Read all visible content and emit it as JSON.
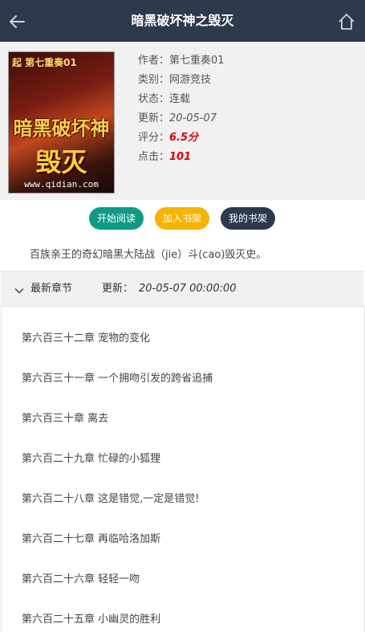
{
  "header": {
    "title": "暗黑破坏神之毁灭",
    "back_icon": "back-arrow-icon",
    "home_icon": "home-icon"
  },
  "book": {
    "cover": {
      "top_text": "起 第七重奏01",
      "title_line": "暗黑破坏神",
      "sub_line": "毁灭",
      "url": "www.qidian.com"
    },
    "meta": [
      {
        "label": "作者：",
        "value": "第七重奏01"
      },
      {
        "label": "类别：",
        "value": "网游竞技"
      },
      {
        "label": "状态：",
        "value": "连载"
      },
      {
        "label": "更新：",
        "value": "20-05-07"
      },
      {
        "label": "评分：",
        "value": "6.5分"
      },
      {
        "label": "点击：",
        "value": "101"
      }
    ],
    "description": "百族亲王的奇幻暗黑大陆战（jie）斗(cao)毁灭史。"
  },
  "actions": {
    "start_reading": "开始阅读",
    "add_shelf": "加入书架",
    "my_shelf": "我的书架"
  },
  "latest": {
    "label": "最新章节",
    "update_label": "更新：",
    "update_time": "20-05-07 00:00:00"
  },
  "chapters": [
    "第六百三十二章 宠物的变化",
    "第六百三十一章 一个拥吻引发的跨省追捕",
    "第六百三十章 离去",
    "第六百二十九章 忙碌的小狐狸",
    "第六百二十八章 这是错觉,一定是错觉!",
    "第六百二十七章 再临哈洛加斯",
    "第六百二十六章 轻轻一吻",
    "第六百二十五章 小幽灵的胜利"
  ],
  "colors": {
    "header_bg": "#2d3a4c",
    "read_btn": "#0d9b86",
    "add_btn": "#f5b400",
    "shelf_btn": "#2d3a4c",
    "highlight_red": "#e00000"
  }
}
